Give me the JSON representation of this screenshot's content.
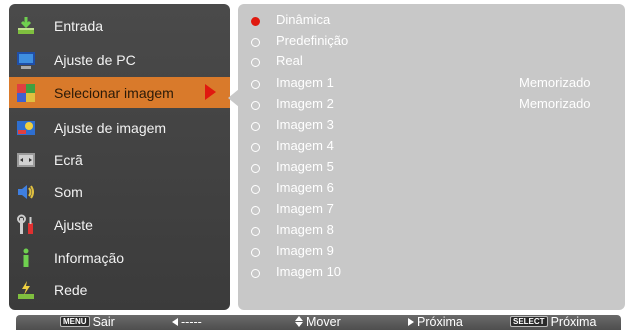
{
  "menu": {
    "items": [
      {
        "label": "Entrada",
        "icon": "input-icon"
      },
      {
        "label": "Ajuste de PC",
        "icon": "pc-monitor-icon"
      },
      {
        "label": "Selecionar imagem",
        "icon": "image-select-icon",
        "selected": true
      },
      {
        "label": "Ajuste de imagem",
        "icon": "image-adjust-icon"
      },
      {
        "label": "Ecrã",
        "icon": "screen-icon"
      },
      {
        "label": "Som",
        "icon": "speaker-icon"
      },
      {
        "label": "Ajuste",
        "icon": "wrench-icon"
      },
      {
        "label": "Informação",
        "icon": "info-icon"
      },
      {
        "label": "Rede",
        "icon": "network-icon"
      }
    ]
  },
  "options": [
    {
      "label": "Dinâmica",
      "active": true,
      "status": ""
    },
    {
      "label": "Predefinição",
      "active": false,
      "status": ""
    },
    {
      "label": "Real",
      "active": false,
      "status": ""
    },
    {
      "label": "Imagem 1",
      "active": false,
      "status": "Memorizado"
    },
    {
      "label": "Imagem 2",
      "active": false,
      "status": "Memorizado"
    },
    {
      "label": "Imagem 3",
      "active": false,
      "status": ""
    },
    {
      "label": "Imagem 4",
      "active": false,
      "status": ""
    },
    {
      "label": "Imagem 5",
      "active": false,
      "status": ""
    },
    {
      "label": "Imagem 6",
      "active": false,
      "status": ""
    },
    {
      "label": "Imagem 7",
      "active": false,
      "status": ""
    },
    {
      "label": "Imagem 8",
      "active": false,
      "status": ""
    },
    {
      "label": "Imagem 9",
      "active": false,
      "status": ""
    },
    {
      "label": "Imagem 10",
      "active": false,
      "status": ""
    }
  ],
  "bottom_bar": {
    "menu_key": "MENU",
    "exit_label": "Sair",
    "back_label": "-----",
    "move_label": "Mover",
    "next_label": "Próxima",
    "select_key": "SELECT",
    "select_next_label": "Próxima"
  },
  "colors": {
    "accent": "#d97a2b",
    "active_dot": "#e0190f",
    "panel_dark": "#444444",
    "panel_light": "#c8c8c8"
  }
}
